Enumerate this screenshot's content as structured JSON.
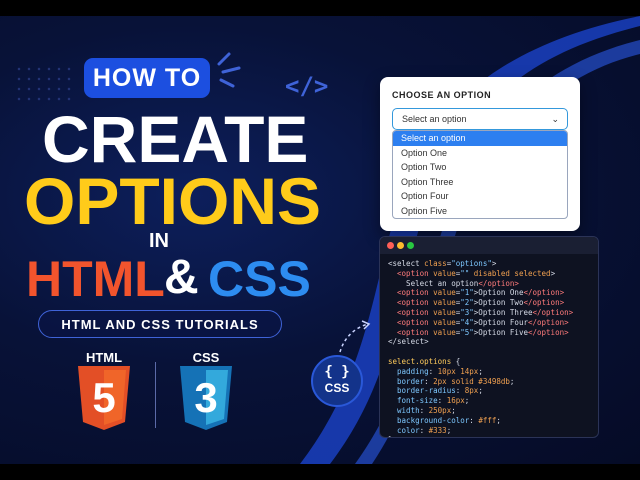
{
  "banner": {
    "how_to": "HOW TO",
    "line_create": "CREATE",
    "line_options": "OPTIONS",
    "line_in": "IN",
    "html": "HTML",
    "amp": "&",
    "css": "CSS",
    "subtitle": "HTML AND CSS TUTORIALS",
    "brackets": "</>"
  },
  "logos": {
    "html_label": "HTML",
    "html_number": "5",
    "css_label": "CSS",
    "css_number": "3"
  },
  "select_demo": {
    "title": "CHOOSE AN OPTION",
    "selected": "Select an option",
    "options": [
      "Select an option",
      "Option One",
      "Option Two",
      "Option Three",
      "Option Four",
      "Option Five"
    ]
  },
  "css_badge": {
    "braces": "{ }",
    "label": "CSS"
  },
  "colors": {
    "html_orange": "#f2542d",
    "css_blue": "#2d8cf0",
    "yellow": "#ffcb1a",
    "brand_blue": "#1c4fe0"
  }
}
